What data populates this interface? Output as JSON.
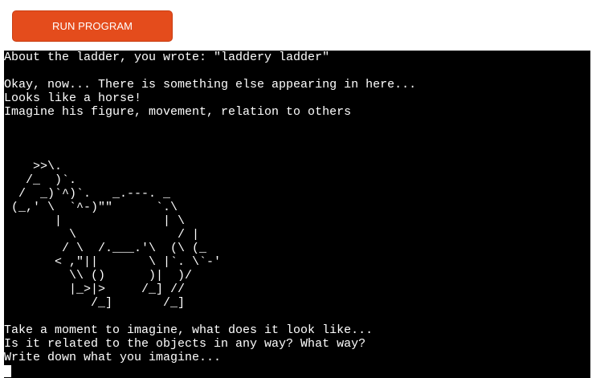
{
  "toolbar": {
    "run_label": "RUN PROGRAM"
  },
  "colors": {
    "run_button": "#e44c1c",
    "terminal_background": "#000000",
    "terminal_text": "#ffffff"
  },
  "terminal": {
    "output": "About the ladder, you wrote: \"laddery ladder\"\n\nOkay, now... There is something else appearing in here...\nLooks like a horse!\nImagine his figure, movement, relation to others\n\n\n\n    >>\\.\n   /_  )`.\n  /  _)`^)`.   _.---. _\n (_,' \\  `^-)\"\"      `.\\\n       |              | \\\n         \\              / |\n        / \\  /.___.'\\  (\\ (_\n       < ,\"||       \\ |`. \\`-'\n         \\\\ ()      )|  )/\n         |_>|>     /_] //\n            /_]       /_]\n\nTake a moment to imagine, what does it look like...\nIs it related to the objects in any way? What way?\nWrite down what you imagine..."
  }
}
